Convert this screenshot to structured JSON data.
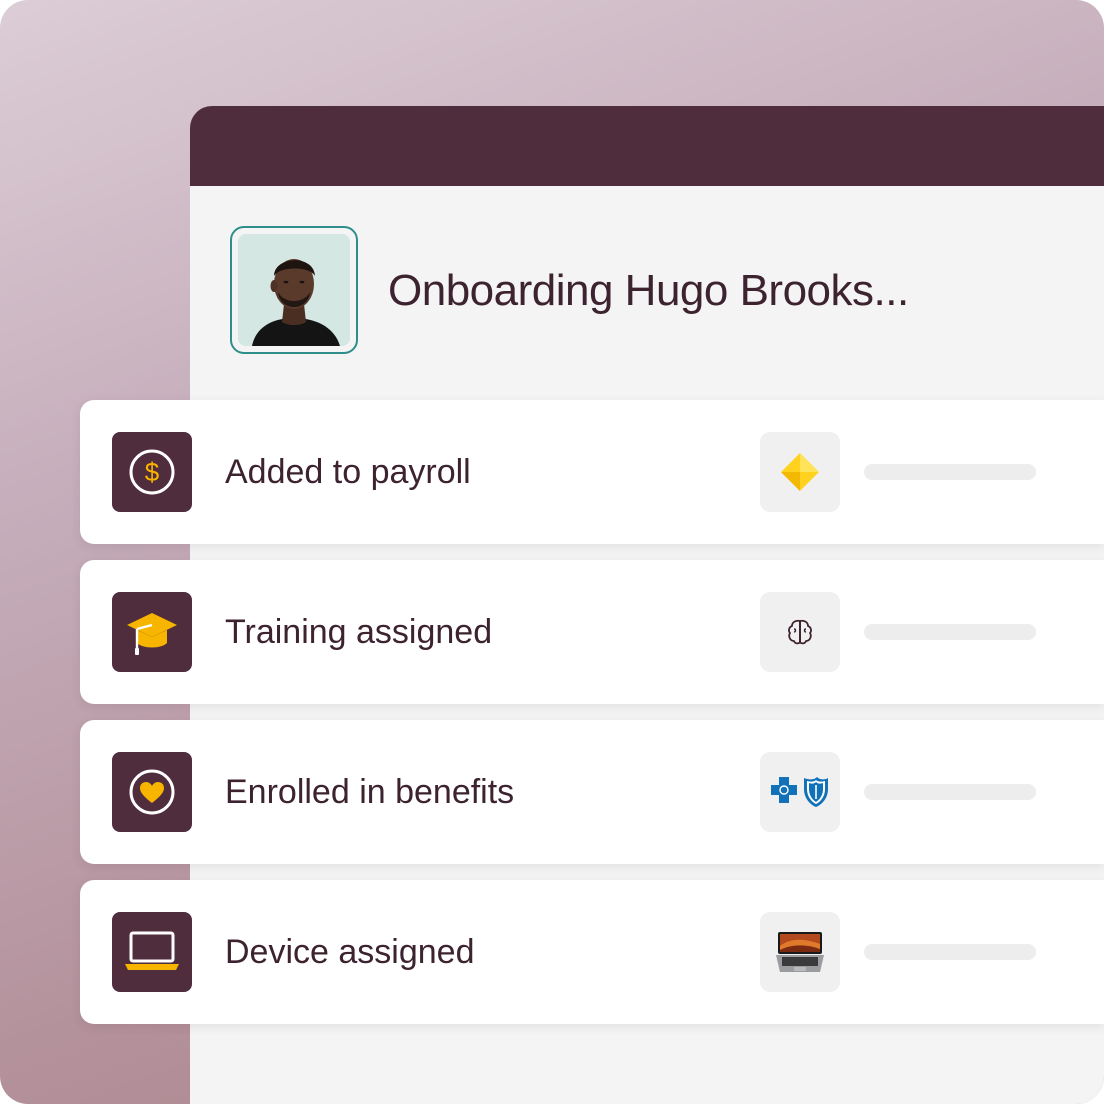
{
  "page": {
    "title": "Onboarding Hugo Brooks...",
    "avatar_name": "Hugo Brooks"
  },
  "colors": {
    "brand": "#502d3c",
    "accent": "#f7b500",
    "avatar_border": "#2e8f8a",
    "text": "#3d2330"
  },
  "tasks": [
    {
      "label": "Added to payroll",
      "icon": "dollar-coin-icon",
      "vendor_icon": "yellow-diamond-logo-icon"
    },
    {
      "label": "Training assigned",
      "icon": "graduation-cap-icon",
      "vendor_icon": "brain-icon"
    },
    {
      "label": "Enrolled in benefits",
      "icon": "heart-circle-icon",
      "vendor_icon": "blue-cross-blue-shield-logo-icon"
    },
    {
      "label": "Device assigned",
      "icon": "laptop-icon",
      "vendor_icon": "macbook-icon"
    }
  ]
}
